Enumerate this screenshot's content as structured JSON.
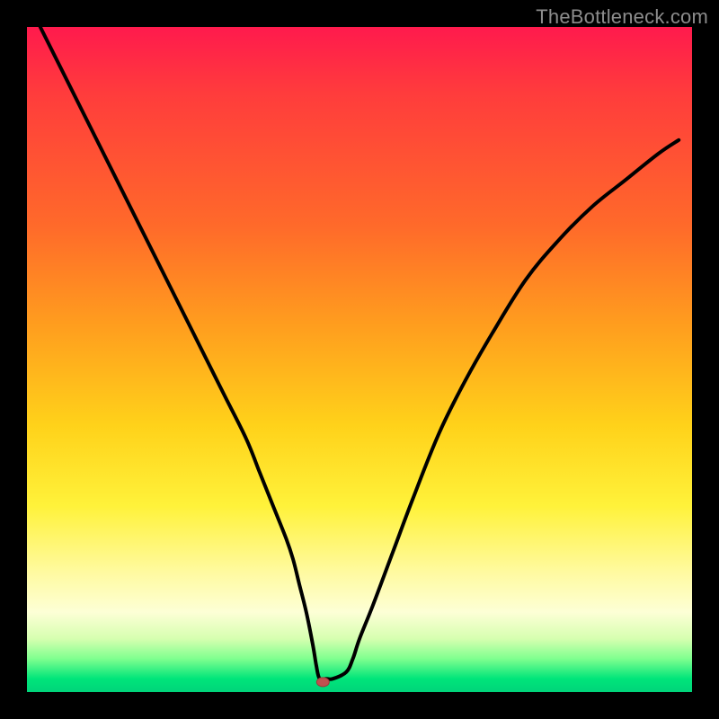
{
  "watermark": "TheBottleneck.com",
  "chart_data": {
    "type": "line",
    "title": "",
    "xlabel": "",
    "ylabel": "",
    "xlim": [
      0,
      100
    ],
    "ylim": [
      0,
      100
    ],
    "grid": false,
    "annotations": [],
    "series": [
      {
        "name": "bottleneck-curve",
        "color": "#000000",
        "x": [
          2,
          5,
          10,
          15,
          20,
          25,
          28,
          30,
          33,
          35,
          37,
          39,
          40,
          41,
          42,
          43,
          43.5,
          44,
          45,
          46,
          48,
          49,
          50,
          52,
          55,
          58,
          62,
          66,
          70,
          75,
          80,
          85,
          90,
          95,
          98
        ],
        "y": [
          100,
          94,
          84,
          74,
          64,
          54,
          48,
          44,
          38,
          33,
          28,
          23,
          20,
          16,
          12,
          7,
          4,
          2,
          2,
          2,
          3,
          5,
          8,
          13,
          21,
          29,
          39,
          47,
          54,
          62,
          68,
          73,
          77,
          81,
          83
        ]
      }
    ],
    "markers": [
      {
        "name": "optimal-point",
        "x": 44.5,
        "y": 1.5,
        "color": "#c05050",
        "rx": 7,
        "ry": 5
      }
    ],
    "gradient_stops": [
      {
        "pos": 0.0,
        "color": "#ff1a4d"
      },
      {
        "pos": 0.3,
        "color": "#ff6a2a"
      },
      {
        "pos": 0.6,
        "color": "#ffd21a"
      },
      {
        "pos": 0.85,
        "color": "#fdffd6"
      },
      {
        "pos": 0.95,
        "color": "#7fff8f"
      },
      {
        "pos": 1.0,
        "color": "#00d47a"
      }
    ]
  }
}
